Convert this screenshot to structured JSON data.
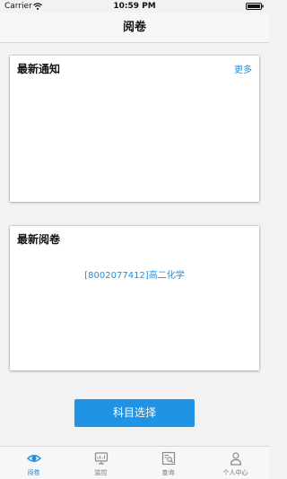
{
  "status_bar": {
    "carrier": "Carrier",
    "time": "10:59 PM"
  },
  "nav": {
    "title": "阅卷"
  },
  "notices": {
    "title": "最新通知",
    "more_label": "更多"
  },
  "recent": {
    "title": "最新阅卷",
    "item": "[8002077412]高二化学"
  },
  "actions": {
    "primary_label": "科目选择"
  },
  "tabs": [
    {
      "label": "阅卷",
      "icon": "eye-icon",
      "active": true
    },
    {
      "label": "监控",
      "icon": "monitor-icon",
      "active": false
    },
    {
      "label": "查询",
      "icon": "search-document-icon",
      "active": false
    },
    {
      "label": "个人中心",
      "icon": "person-icon",
      "active": false
    }
  ],
  "colors": {
    "accent": "#1f94e4",
    "link": "#1f8fe0",
    "background": "#f2f2f4"
  }
}
